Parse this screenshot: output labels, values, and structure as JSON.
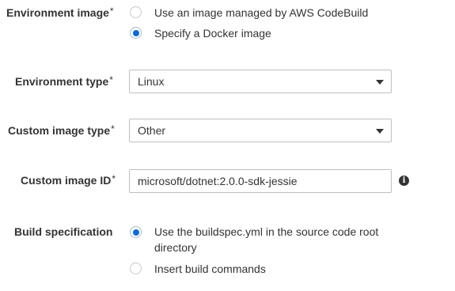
{
  "environment_image": {
    "label": "Environment image",
    "required_mark": "*",
    "options": [
      {
        "label": "Use an image managed by AWS CodeBuild",
        "selected": false
      },
      {
        "label": "Specify a Docker image",
        "selected": true
      }
    ]
  },
  "environment_type": {
    "label": "Environment type",
    "required_mark": "*",
    "value": "Linux"
  },
  "custom_image_type": {
    "label": "Custom image type",
    "required_mark": "*",
    "value": "Other"
  },
  "custom_image_id": {
    "label": "Custom image ID",
    "required_mark": "*",
    "value": "microsoft/dotnet:2.0.0-sdk-jessie",
    "info_icon": "info-icon"
  },
  "build_specification": {
    "label": "Build specification",
    "options": [
      {
        "label_line1": "Use the buildspec.yml in the source code root",
        "label_line2": "directory",
        "selected": true
      },
      {
        "label": "Insert build commands",
        "selected": false
      }
    ]
  },
  "colors": {
    "radio_selected": "#0d6bd6",
    "text": "#333333",
    "border": "#bfbfbf"
  }
}
